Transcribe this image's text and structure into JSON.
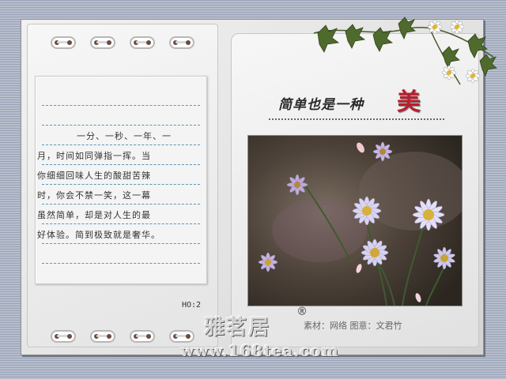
{
  "note": {
    "lines": [
      "一分、一秒、一年、一",
      "月，时间如同弹指一挥。当",
      "你细细回味人生的酸甜苦辣",
      "时，你会不禁一笑，这一幕",
      "虽然简单，却是对人生的最",
      "好体验。简到极致就是奢华。"
    ],
    "counter": "HO:2"
  },
  "title": {
    "part1": "简单也是一种",
    "part2": "美"
  },
  "credit": "素材：网络  图意：文君竹",
  "brand": {
    "name": "雅茗居",
    "mark": "®",
    "site": "www.168tea.com"
  },
  "colors": {
    "accent": "#b81f2c",
    "rule": "#5b95b8"
  }
}
